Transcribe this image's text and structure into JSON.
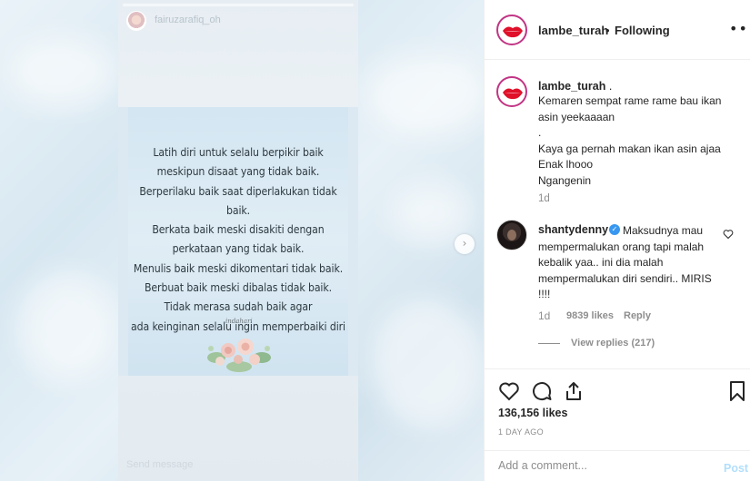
{
  "story": {
    "username": "fairuzarafiq_oh",
    "quote_lines": [
      "Latih diri untuk selalu berpikir baik",
      "meskipun disaat yang tidak baik.",
      "Berperilaku baik saat diperlakukan tidak baik.",
      "Berkata baik meski disakiti dengan",
      "perkataan yang tidak baik.",
      "Menulis baik meski dikomentari tidak baik.",
      "Berbuat baik meski dibalas tidak baik.",
      "Tidak merasa sudah baik agar",
      "ada keinginan selalu ingin memperbaiki diri"
    ],
    "signature": "indahari",
    "send_message_placeholder": "Send message"
  },
  "post": {
    "username": "lambe_turah",
    "separator": "•",
    "follow_status": "Following",
    "caption_username": "lambe_turah",
    "caption_lines": [
      ".",
      "Kemaren sempat rame rame bau ikan asin yeekaaaan",
      ".",
      "Kaya ga pernah makan ikan asin ajaa",
      "Enak lhooo",
      "Ngangenin"
    ],
    "caption_time": "1d",
    "comment": {
      "username": "shantydenny",
      "text": "Maksudnya mau mempermalukan orang tapi malah kebalik yaa.. ini dia malah mempermalukan diri sendiri.. MIRIS !!!!",
      "time": "1d",
      "likes": "9839 likes",
      "reply_label": "Reply",
      "view_replies": "View replies (217)"
    },
    "likes": "136,156 likes",
    "posted_ago": "1 DAY AGO",
    "add_comment_placeholder": "Add a comment...",
    "post_label": "Post"
  },
  "icons": [
    "heart-icon",
    "comment-icon",
    "share-icon",
    "bookmark-icon",
    "more-icon",
    "next-arrow-icon",
    "verified-icon"
  ],
  "colors": {
    "accent_link": "#b2dffc",
    "verified": "#3897f0",
    "story_ring": "#c13584",
    "lips": "#e0102a"
  }
}
